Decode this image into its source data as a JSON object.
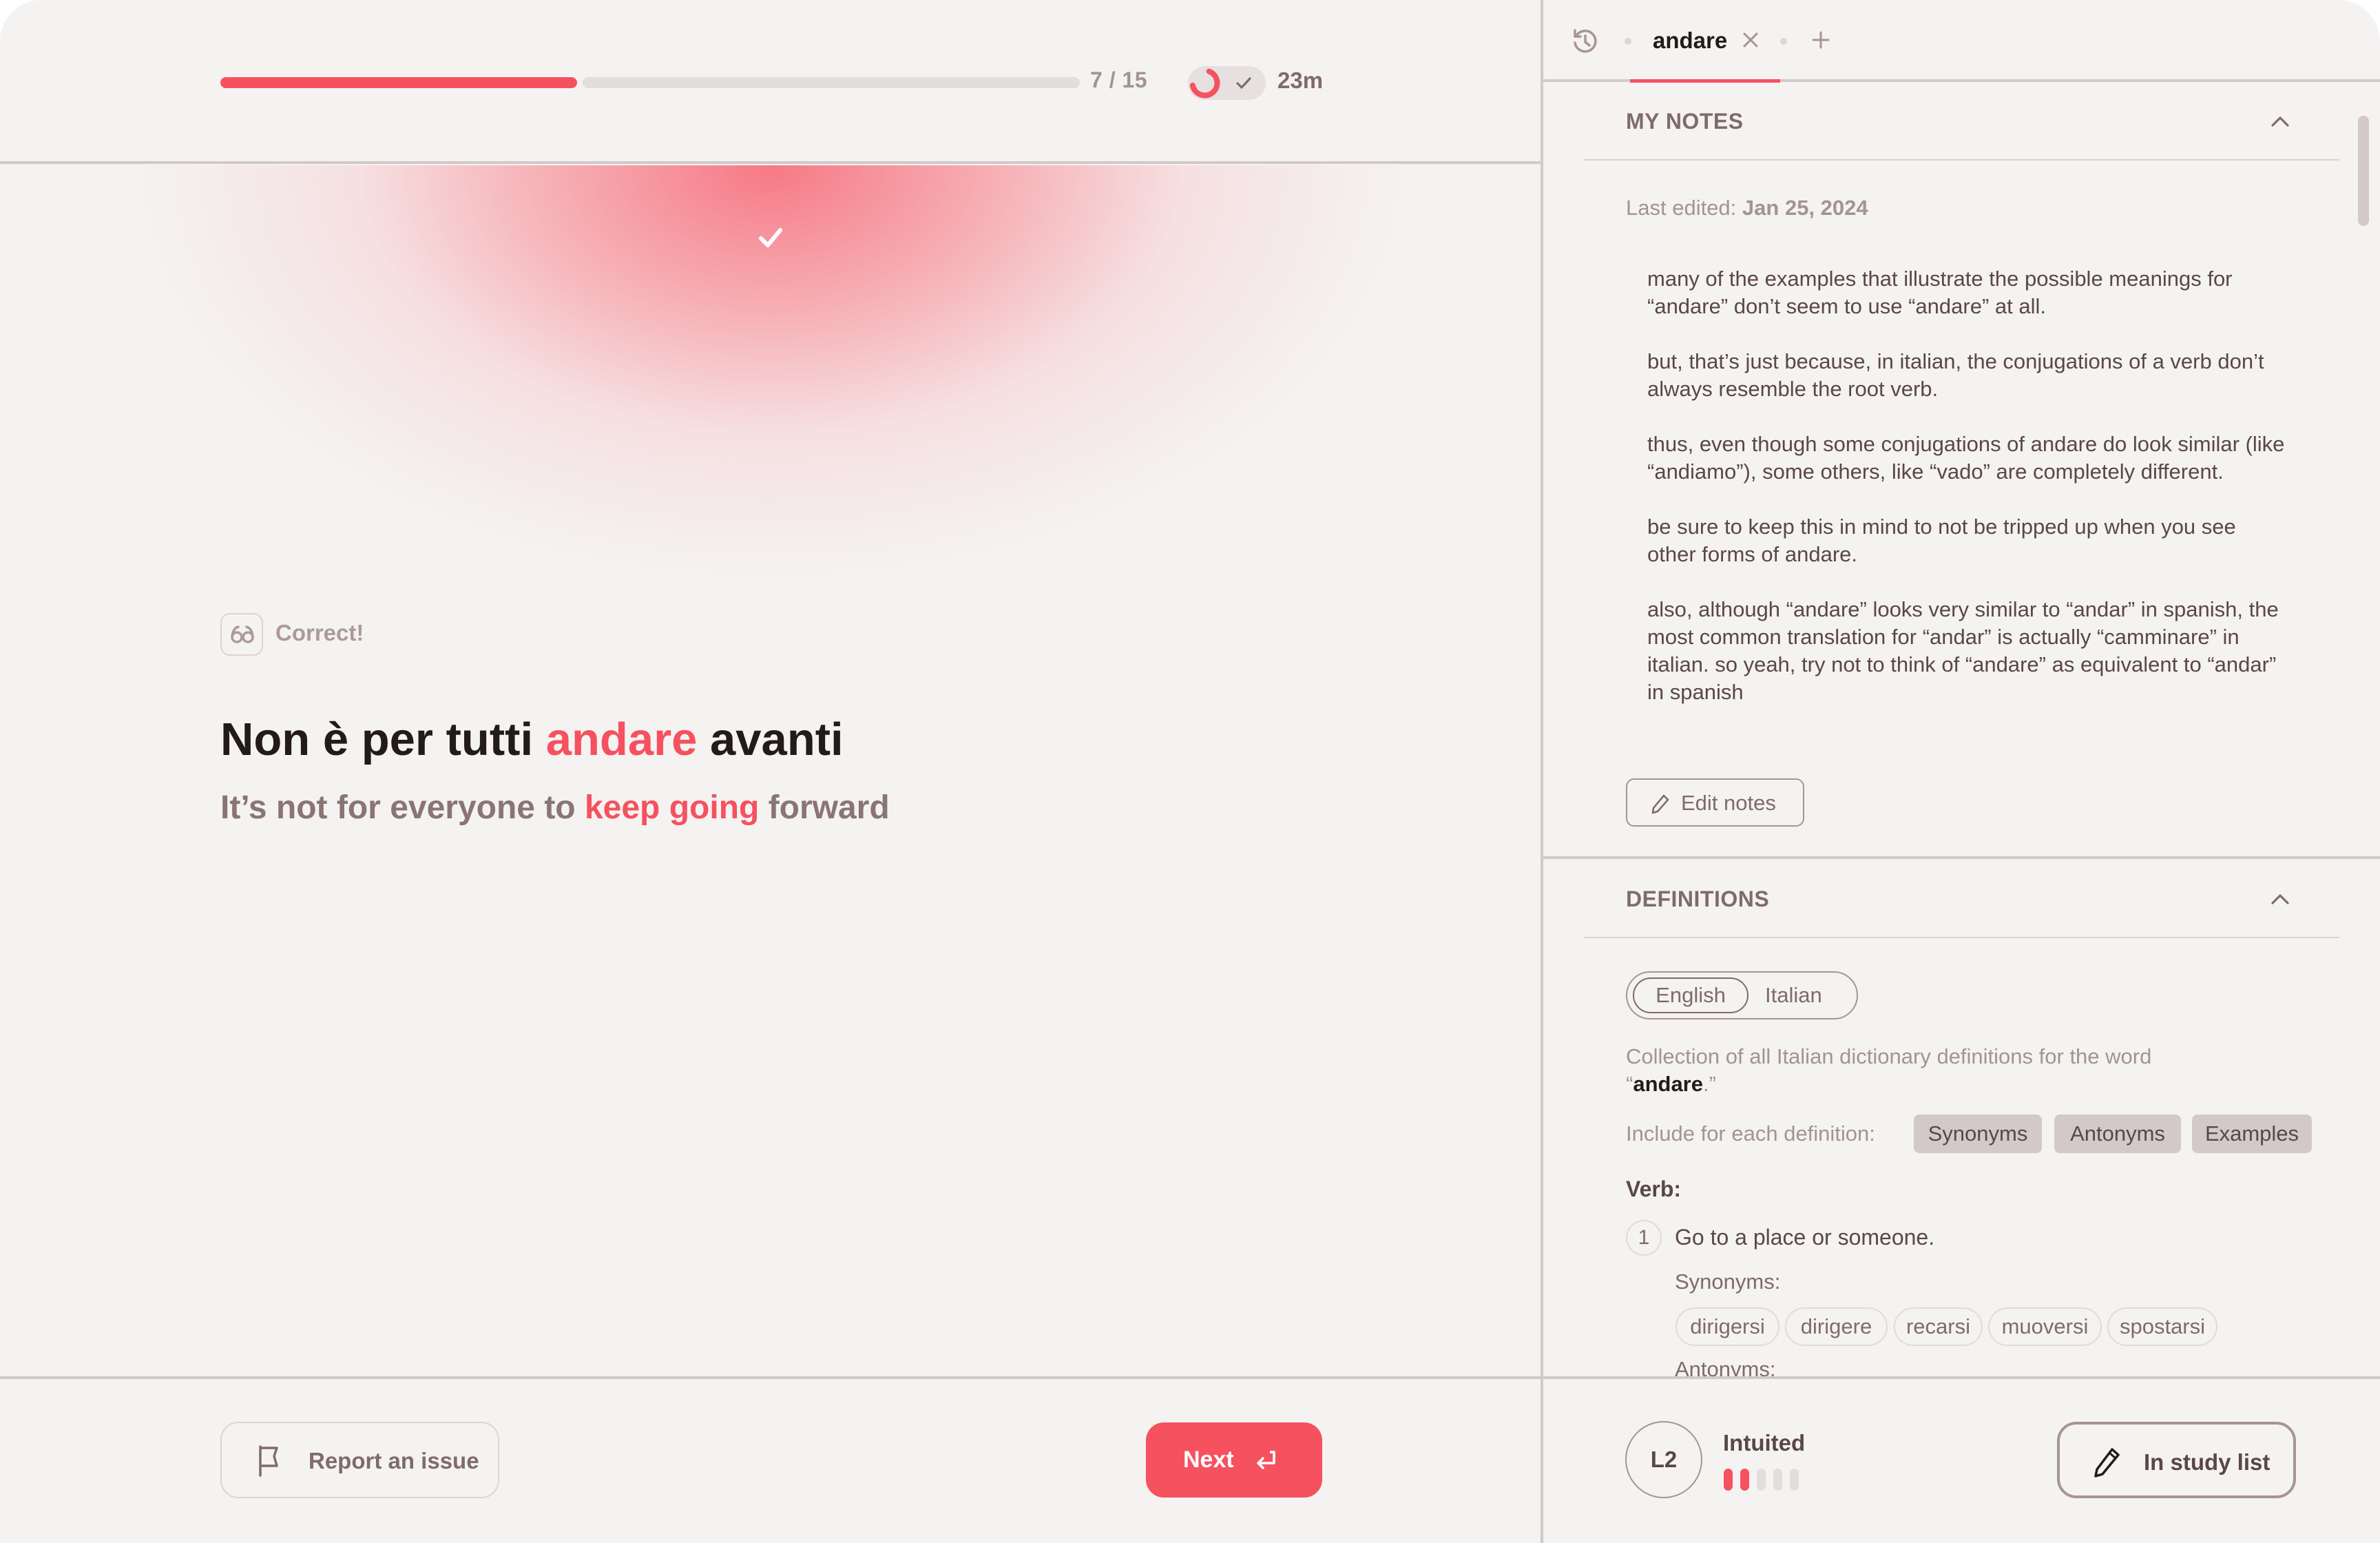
{
  "session": {
    "progress": {
      "current": 7,
      "total": 15,
      "label": "7 / 15"
    },
    "timer": {
      "label": "23m",
      "ring_fraction": 0.6
    }
  },
  "feedback": {
    "status_icon": "check-icon",
    "result_icon": "glasses-icon",
    "result_label": "Correct!"
  },
  "sentence": {
    "italian": {
      "before": "Non è per tutti ",
      "highlight": "andare",
      "after": " avanti"
    },
    "english": {
      "before": "It’s not for everyone to ",
      "highlight": "keep going",
      "after": " forward"
    }
  },
  "footer_left": {
    "report_label": "Report an issue",
    "report_icon": "flag-icon",
    "next_label": "Next",
    "next_icon": "enter-icon"
  },
  "tabs": {
    "history_icon": "history-icon",
    "items": [
      {
        "label": "andare",
        "active": true
      }
    ],
    "close_icon": "close-icon",
    "add_icon": "plus-icon"
  },
  "notes": {
    "title": "MY NOTES",
    "last_edited_prefix": "Last edited:",
    "last_edited_date": "Jan 25, 2024",
    "paragraphs": [
      "many of the examples that illustrate the possible meanings for “andare” don’t seem to use “andare” at all.",
      "but, that’s just because, in italian, the conjugations of a verb don’t always resemble the root verb.",
      "thus, even though some conjugations of andare do look similar (like “andiamo”), some others, like “vado” are completely different.",
      "be sure to keep this in mind to not be tripped up when you see other forms of andare.",
      "also, although “andare” looks very similar to “andar” in spanish, the most common translation for “andar” is actually “camminare” in italian. so yeah, try not to think of “andare” as equivalent to “andar” in spanish"
    ],
    "edit_label": "Edit notes"
  },
  "definitions": {
    "title": "DEFINITIONS",
    "languages": [
      "English",
      "Italian"
    ],
    "selected_language": "English",
    "collection_prefix": "Collection of all Italian dictionary definitions for the word “",
    "collection_word": "andare",
    "collection_suffix": ".”",
    "include_label": "Include for each definition:",
    "include_options": [
      "Synonyms",
      "Antonyms",
      "Examples"
    ],
    "part_of_speech": "Verb:",
    "entries": [
      {
        "number": "1",
        "text": "Go to a place or someone.",
        "synonyms_label": "Synonyms:",
        "synonyms": [
          "dirigersi",
          "dirigere",
          "recarsi",
          "muoversi",
          "spostarsi"
        ],
        "antonyms_label": "Antonyms:"
      }
    ]
  },
  "footer_right": {
    "level": "L2",
    "level_name": "Intuited",
    "level_progress": {
      "filled": 2,
      "total": 5
    },
    "study_label": "In study list",
    "study_icon": "pencil-icon"
  },
  "colors": {
    "accent": "#f5515f",
    "background": "#f5f2f2",
    "divider": "#d3c9c9",
    "text_dark": "#231b1b",
    "text_muted": "#a39393"
  }
}
